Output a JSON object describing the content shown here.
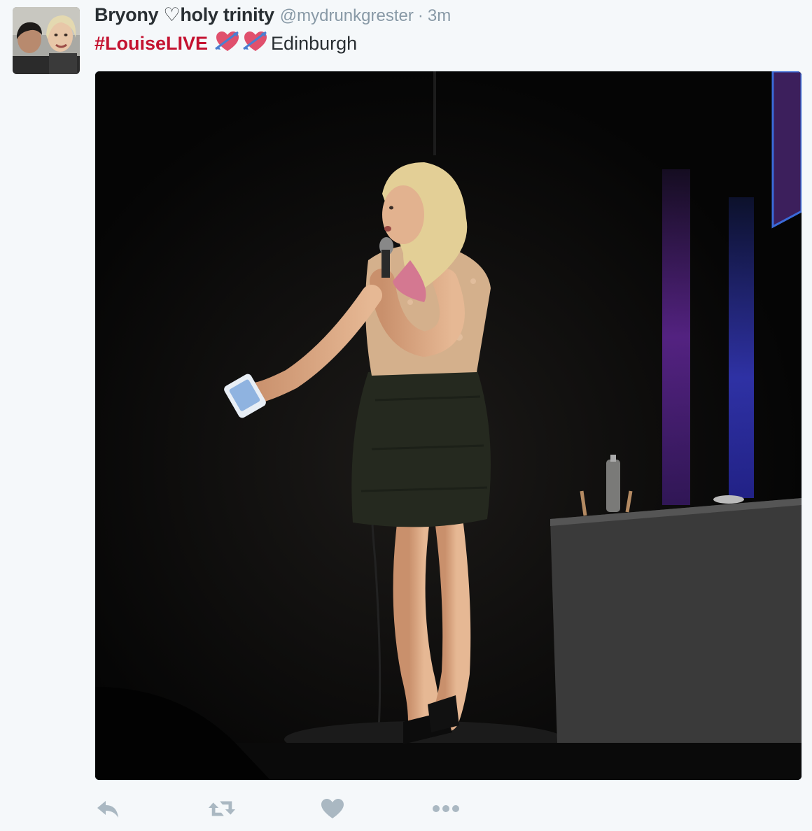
{
  "tweet": {
    "display_name": "Bryony ♡holy trinity",
    "handle": "@mydrunkgrester",
    "separator": "·",
    "time": "3m",
    "hashtag": "#LouiseLIVE",
    "emojis": [
      "heart-with-arrow-icon",
      "heart-with-arrow-icon"
    ],
    "location_text": "Edinburgh"
  },
  "actions": [
    {
      "name": "reply-icon"
    },
    {
      "name": "retweet-icon"
    },
    {
      "name": "like-icon"
    },
    {
      "name": "more-icon"
    }
  ],
  "colors": {
    "background": "#f5f8fa",
    "name": "#292f33",
    "secondary": "#8899a6",
    "hashtag": "#c41230",
    "action_icon": "#aab8c2"
  }
}
